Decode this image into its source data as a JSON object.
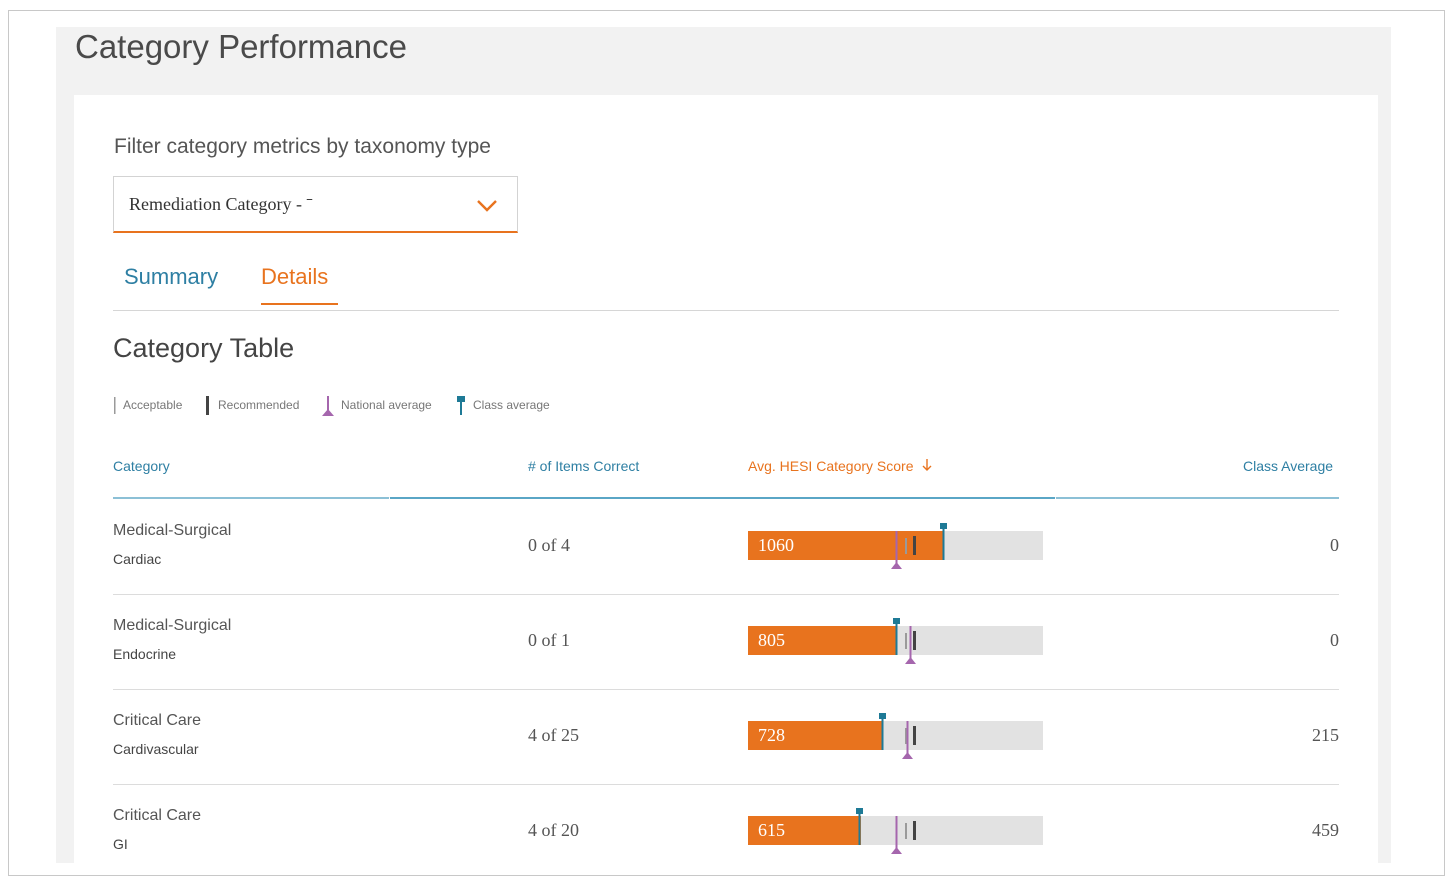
{
  "page_title": "Category Performance",
  "filter": {
    "label": "Filter category metrics by taxonomy type",
    "selected_value": "Remediation Category ‐ ˉ"
  },
  "tabs": [
    {
      "label": "Summary",
      "active": false
    },
    {
      "label": "Details",
      "active": true
    }
  ],
  "section_title": "Category Table",
  "legend": {
    "acceptable": "Acceptable",
    "recommended": "Recommended",
    "national_average": "National average",
    "class_average": "Class average"
  },
  "table": {
    "headers": {
      "category": "Category",
      "items_correct": "# of Items Correct",
      "score": "Avg. HESI Category Score",
      "class_average": "Class Average"
    },
    "sort_icon": "arrow-down-icon",
    "score_max": 1600,
    "rows": [
      {
        "category": "Medical-Surgical",
        "subcategory": "Cardiac",
        "items_correct": "0 of 4",
        "score": "1060",
        "score_value": 1060,
        "class_avg_score": 1060,
        "acceptable": 850,
        "recommended": 900,
        "national_average": 800,
        "class_average": "0"
      },
      {
        "category": "Medical-Surgical",
        "subcategory": "Endocrine",
        "items_correct": "0 of 1",
        "score": "805",
        "score_value": 805,
        "class_avg_score": 805,
        "acceptable": 850,
        "recommended": 900,
        "national_average": 880,
        "class_average": "0"
      },
      {
        "category": "Critical Care",
        "subcategory": "Cardivascular",
        "items_correct": "4 of 25",
        "score": "728",
        "score_value": 728,
        "class_avg_score": 728,
        "acceptable": 850,
        "recommended": 900,
        "national_average": 860,
        "class_average": "215"
      },
      {
        "category": "Critical Care",
        "subcategory": "GI",
        "items_correct": "4 of 20",
        "score": "615",
        "score_value": 615,
        "class_avg_score": 600,
        "acceptable": 850,
        "recommended": 900,
        "national_average": 800,
        "class_average": "459"
      }
    ]
  },
  "colors": {
    "accent_orange": "#e8731e",
    "link_blue": "#2e7fa3",
    "national_purple": "#a566ad",
    "class_teal": "#1e7a96",
    "recommended_dark": "#444444",
    "acceptable_gray": "#9a9a9a"
  }
}
